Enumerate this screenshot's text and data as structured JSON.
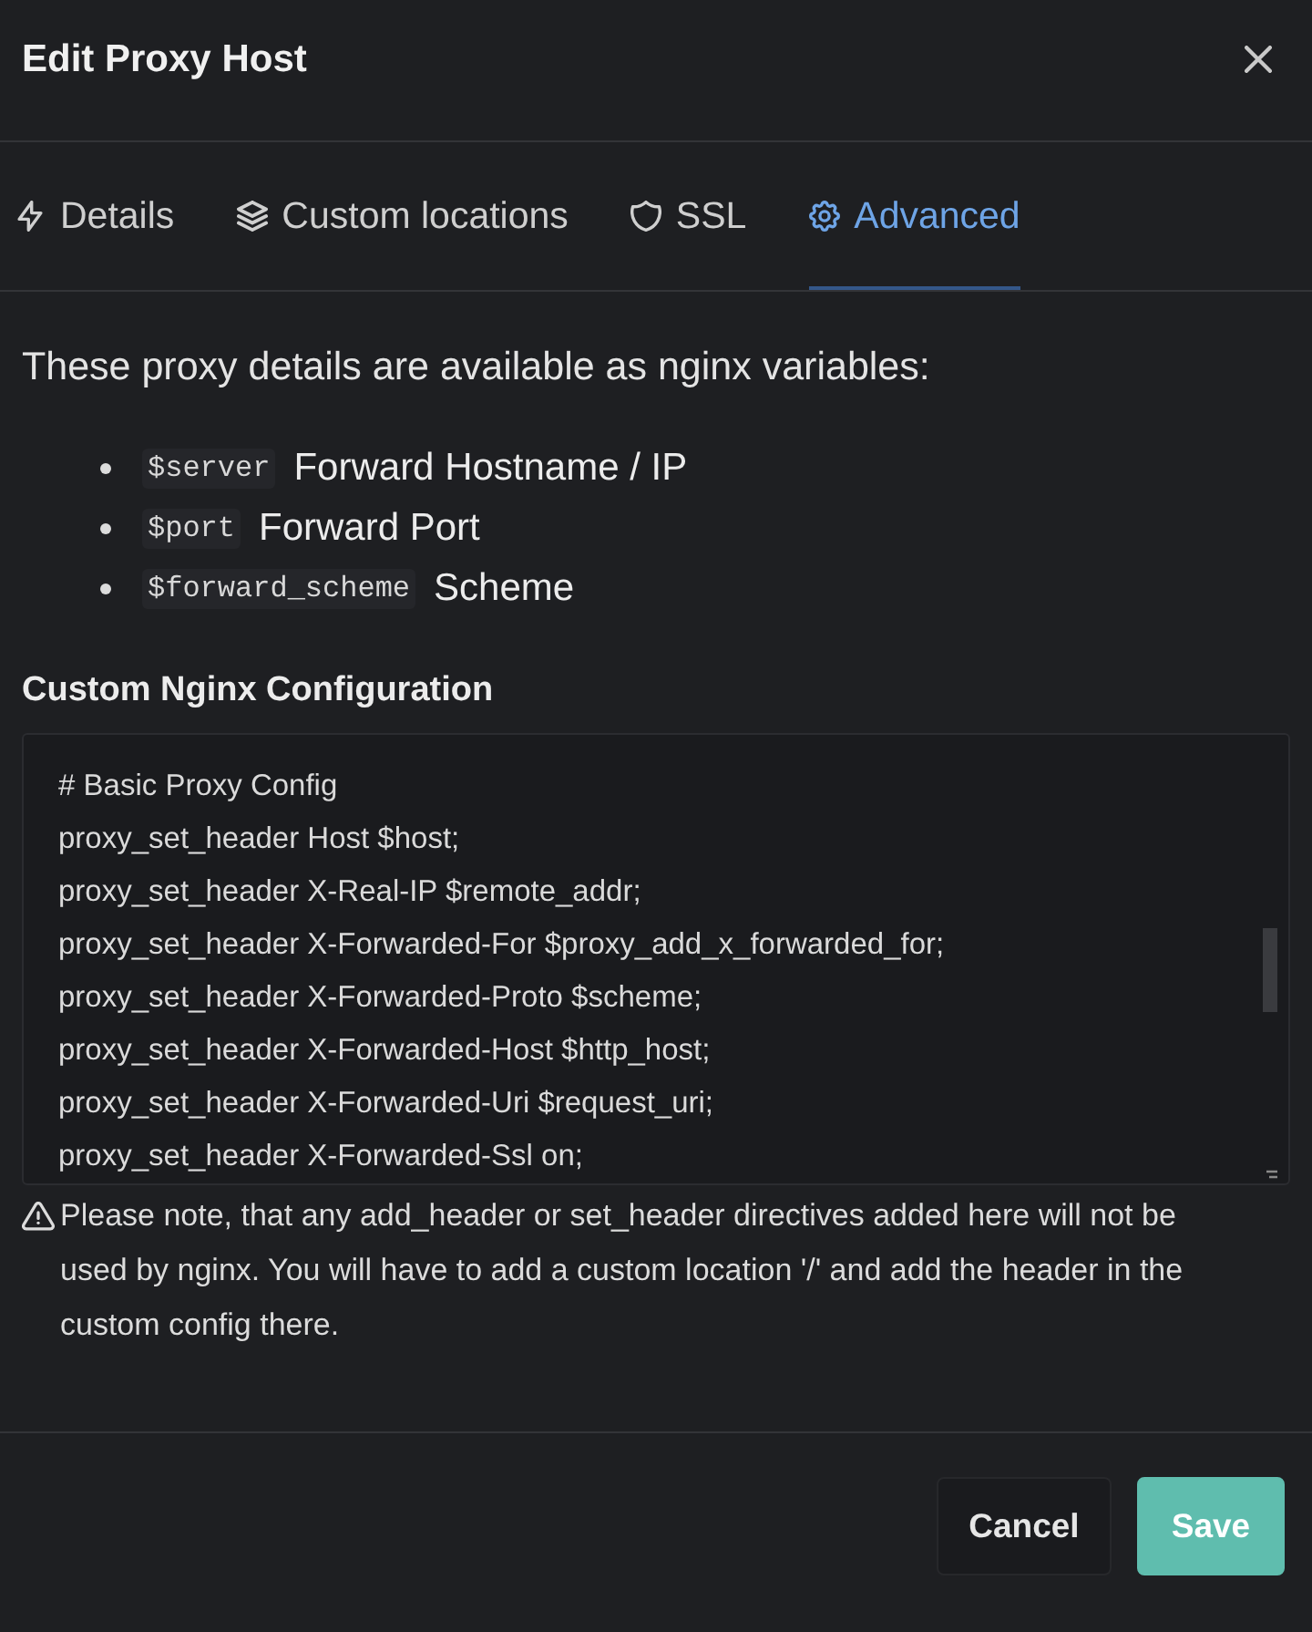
{
  "dialog": {
    "title": "Edit Proxy Host"
  },
  "tabs": [
    {
      "label": "Details",
      "selected": false
    },
    {
      "label": "Custom locations",
      "selected": false
    },
    {
      "label": "SSL",
      "selected": false
    },
    {
      "label": "Advanced",
      "selected": true
    }
  ],
  "intro": "These proxy details are available as nginx variables:",
  "variables": [
    {
      "code": "$server",
      "description": "Forward Hostname / IP"
    },
    {
      "code": "$port",
      "description": "Forward Port"
    },
    {
      "code": "$forward_scheme",
      "description": "Scheme"
    }
  ],
  "config": {
    "label": "Custom Nginx Configuration",
    "lines": [
      "# Basic Proxy Config",
      "proxy_set_header Host $host;",
      "proxy_set_header X-Real-IP $remote_addr;",
      "proxy_set_header X-Forwarded-For $proxy_add_x_forwarded_for;",
      "proxy_set_header X-Forwarded-Proto $scheme;",
      "proxy_set_header X-Forwarded-Host $http_host;",
      "proxy_set_header X-Forwarded-Uri $request_uri;",
      "proxy_set_header X-Forwarded-Ssl on;"
    ]
  },
  "note": "Please note, that any add_header or set_header directives added here will not be used by nginx. You will have to add a custom location '/' and add the header in the custom config there.",
  "buttons": [
    {
      "label": "Cancel",
      "kind": "secondary"
    },
    {
      "label": "Save",
      "kind": "primary"
    }
  ]
}
